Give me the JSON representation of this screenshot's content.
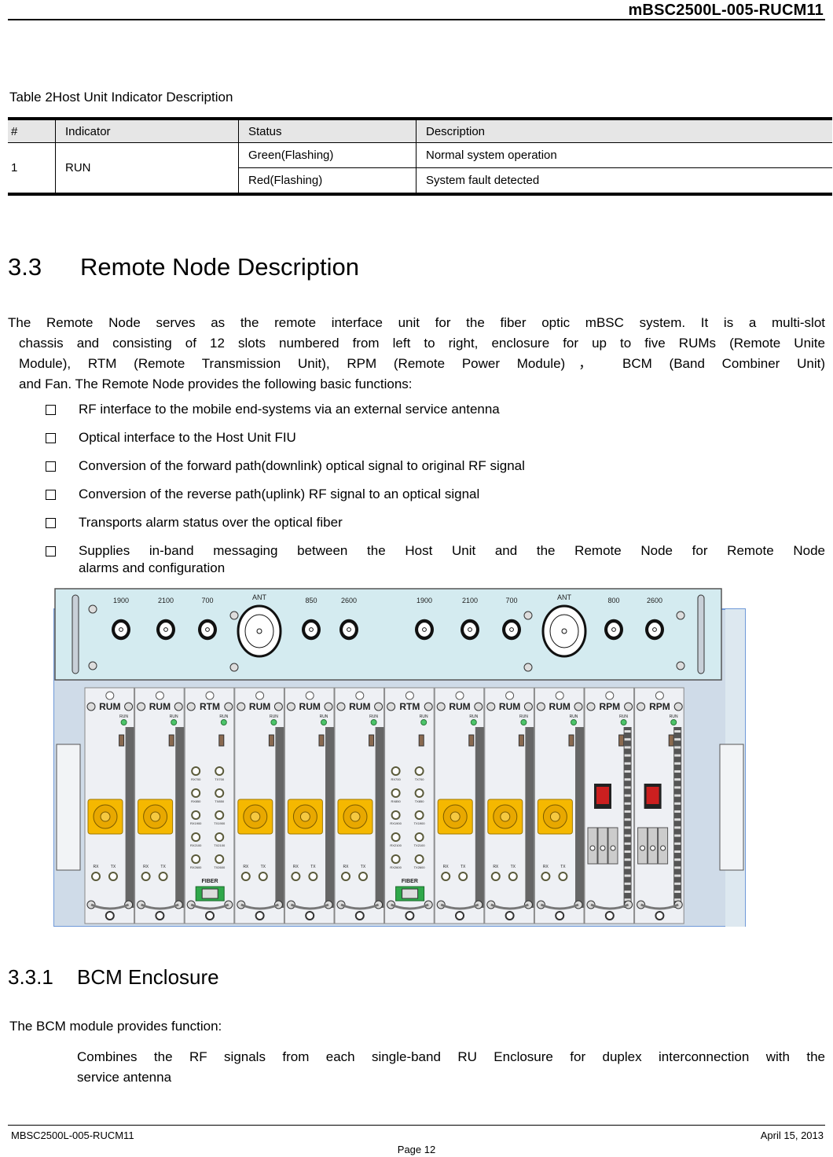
{
  "header": {
    "doc_id": "mBSC2500L-005-RUCM11"
  },
  "table": {
    "caption": "Table 2Host Unit Indicator Description",
    "columns": [
      "#",
      "Indicator",
      "Status",
      "Description"
    ],
    "rows": [
      {
        "num": "1",
        "indicator": "RUN",
        "statuses": [
          {
            "status": "Green(Flashing)",
            "description": "Normal system operation"
          },
          {
            "status": "Red(Flashing)",
            "description": "System fault detected"
          }
        ]
      }
    ]
  },
  "section": {
    "number": "3.3",
    "title": "Remote Node Description",
    "paragraph_lines": [
      "The Remote Node serves as the remote interface unit for the fiber optic mBSC system. It is a multi-slot",
      "chassis and consisting of 12 slots numbered from left to right, enclosure for up to five RUMs (Remote Unite",
      "Module), RTM (Remote Transmission Unit), RPM (Remote Power Module)，  BCM (Band Combiner Unit)",
      "and Fan. The Remote Node provides the following basic functions:"
    ],
    "bullets": [
      "RF interface to the mobile end-systems via an external service antenna",
      "Optical interface to the Host Unit FIU",
      "Conversion of the forward path(downlink) optical signal to original RF signal",
      "Conversion of the reverse path(uplink) RF signal to an optical signal",
      "Transports alarm status over the optical fiber"
    ],
    "bullet_last_line1": "Supplies in-band messaging between the Host Unit and the Remote Node for Remote Node",
    "bullet_last_line2": "alarms and configuration"
  },
  "figure": {
    "top_ports_left": [
      "1900",
      "2100",
      "700",
      "ANT",
      "850",
      "2600"
    ],
    "top_ports_right": [
      "1900",
      "2100",
      "700",
      "ANT",
      "800",
      "2600"
    ],
    "modules": [
      "RUM",
      "RUM",
      "RTM",
      "RUM",
      "RUM",
      "RUM",
      "RTM",
      "RUM",
      "RUM",
      "RUM",
      "RPM",
      "RPM"
    ],
    "run_label": "RUN",
    "rx_label": "RX",
    "tx_label": "TX",
    "fiber_label": "FIBER",
    "rtm_rx_ports": [
      "RX700",
      "RX850",
      "RX1900",
      "RX2100",
      "RX2600"
    ],
    "rtm_tx_ports": [
      "TX700",
      "TX850",
      "TX1900",
      "TX2100",
      "TX2600"
    ],
    "colors": {
      "panel": "#d4ebf0",
      "chassis": "#cfdbe8",
      "module": "#eef0f4",
      "nport": "#f5b800",
      "led": "#4cc46a",
      "switch": "#cc1f1f",
      "fiber": "#2fa84a"
    }
  },
  "subsection": {
    "number": "3.3.1",
    "title": "BCM Enclosure",
    "intro": "The BCM module provides function:",
    "body_line1": "Combines the RF signals from each single-band RU Enclosure for duplex interconnection with the",
    "body_line2": "service antenna"
  },
  "footer": {
    "left": "MBSC2500L-005-RUCM11",
    "right": "April 15, 2013",
    "page": "Page 12"
  }
}
